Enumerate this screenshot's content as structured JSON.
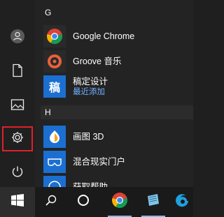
{
  "start_menu": {
    "groups": [
      {
        "header": "G",
        "apps": [
          {
            "name": "Google Chrome",
            "sub": ""
          },
          {
            "name": "Groove 音乐",
            "sub": ""
          },
          {
            "name": "稿定设计",
            "sub": "最近添加"
          }
        ]
      },
      {
        "header": "H",
        "apps": [
          {
            "name": "画图 3D",
            "sub": ""
          },
          {
            "name": "混合现实门户",
            "sub": ""
          },
          {
            "name": "获取帮助",
            "sub": ""
          }
        ]
      }
    ],
    "tile_icons": {
      "gaoding": "稿"
    },
    "rail": [
      "user-icon",
      "document-icon",
      "pictures-icon",
      "settings-icon",
      "power-icon"
    ]
  },
  "taskbar": {
    "items": [
      "windows-logo-icon",
      "search-icon",
      "cortana-icon",
      "chrome-icon",
      "notepad-icon",
      "edge-icon"
    ]
  },
  "colors": {
    "accent_red": "#e0202a",
    "recently_added": "#6fb3ff",
    "tile_blue": "#1b6fd1"
  }
}
